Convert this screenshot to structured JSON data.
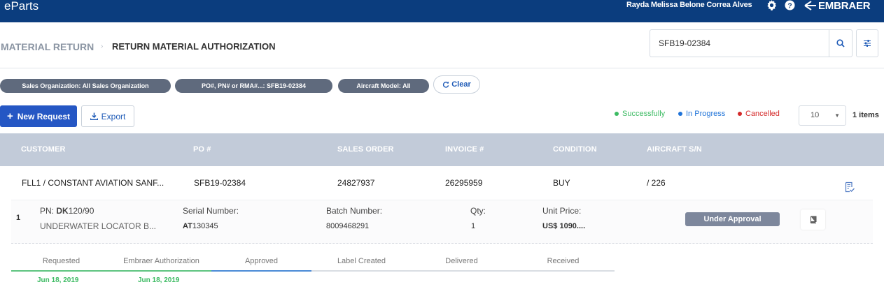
{
  "topbar": {
    "brand": "eParts",
    "user_name": "Rayda Melissa Belone Correa Alves",
    "gear_icon": "gear-icon",
    "help_icon": "help-icon",
    "logo_text": "EMBRAER"
  },
  "header": {
    "breadcrumb_parent": "MATERIAL RETURN",
    "breadcrumb_current": "RETURN MATERIAL AUTHORIZATION",
    "search_value": "SFB19-02384"
  },
  "filters": {
    "chips": [
      "Sales Organization: All Sales Organization",
      "PO#, PN# or RMA#...: SFB19-02384",
      "Aircraft Model: All"
    ],
    "clear_label": "Clear"
  },
  "actions": {
    "new_request_label": "New Request",
    "export_label": "Export"
  },
  "legend": {
    "items": [
      {
        "label": "Successfully",
        "color": "#3dbb63"
      },
      {
        "label": "In Progress",
        "color": "#1f73d8"
      },
      {
        "label": "Cancelled",
        "color": "#d42a2a"
      }
    ]
  },
  "pagination": {
    "page_size": "10",
    "items_count": "1 items"
  },
  "table": {
    "columns": [
      "CUSTOMER",
      "PO #",
      "SALES ORDER",
      "INVOICE #",
      "CONDITION",
      "AIRCRAFT S/N"
    ],
    "row": {
      "customer": "FLL1 / CONSTANT AVIATION SANF...",
      "po": "SFB19-02384",
      "sales_order": "24827937",
      "invoice": "26295959",
      "condition": "BUY",
      "aircraft_sn": "/ 226"
    },
    "detail": {
      "line_number": "1",
      "pn_label": "PN:",
      "pn_prefix": "DK",
      "pn_suffix": "120/90",
      "description": "UNDERWATER LOCATOR B...",
      "serial_label": "Serial Number:",
      "serial_prefix": "AT",
      "serial_suffix": "130345",
      "batch_label": "Batch Number:",
      "batch_value": "8009468291",
      "qty_label": "Qty:",
      "qty_value": "1",
      "price_label": "Unit Price:",
      "price_value": "US$ 1090....",
      "status": "Under Approval"
    }
  },
  "steps": {
    "labels": [
      "Requested",
      "Embraer Authorization",
      "Approved",
      "Label Created",
      "Delivered",
      "Received"
    ],
    "dates": [
      "Jun 18, 2019",
      "Jun 18, 2019"
    ]
  }
}
